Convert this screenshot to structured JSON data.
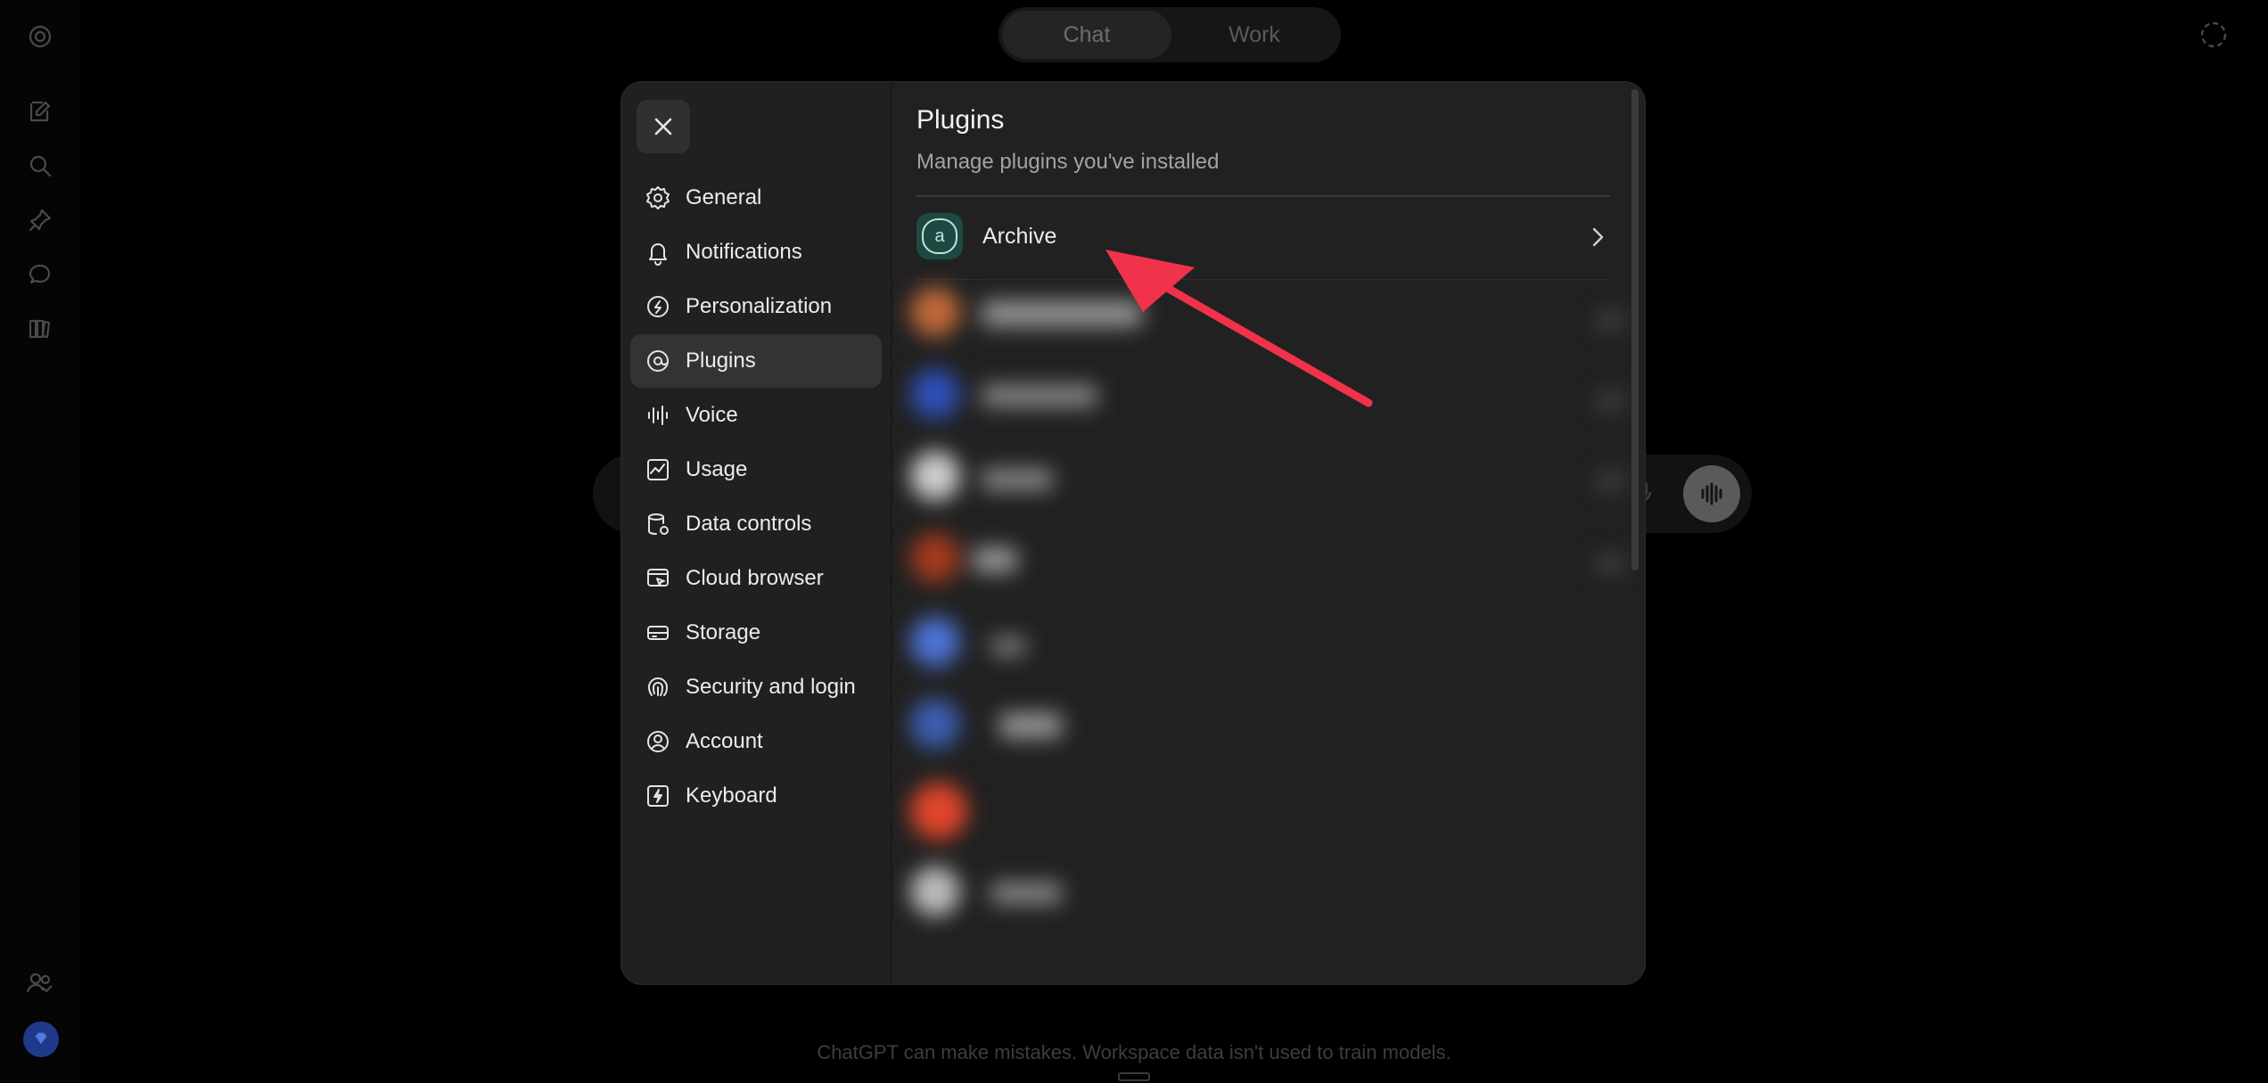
{
  "top_bar": {
    "tabs": [
      {
        "label": "Chat",
        "active": true
      },
      {
        "label": "Work",
        "active": false
      }
    ]
  },
  "left_rail": {
    "icons": [
      "logo-icon",
      "new-chat-icon",
      "search-icon",
      "pin-icon",
      "chat-bubble-icon",
      "library-icon",
      "team-icon",
      "avatar"
    ]
  },
  "settings": {
    "nav": [
      {
        "label": "General",
        "icon": "gear-icon",
        "active": false
      },
      {
        "label": "Notifications",
        "icon": "bell-icon",
        "active": false
      },
      {
        "label": "Personalization",
        "icon": "personalization-icon",
        "active": false
      },
      {
        "label": "Plugins",
        "icon": "plugin-icon",
        "active": true
      },
      {
        "label": "Voice",
        "icon": "waveform-icon",
        "active": false
      },
      {
        "label": "Usage",
        "icon": "usage-chart-icon",
        "active": false
      },
      {
        "label": "Data controls",
        "icon": "database-icon",
        "active": false
      },
      {
        "label": "Cloud browser",
        "icon": "cloud-browser-icon",
        "active": false
      },
      {
        "label": "Storage",
        "icon": "storage-icon",
        "active": false
      },
      {
        "label": "Security and login",
        "icon": "fingerprint-icon",
        "active": false
      },
      {
        "label": "Account",
        "icon": "user-circle-icon",
        "active": false
      },
      {
        "label": "Keyboard",
        "icon": "bolt-icon",
        "active": false
      }
    ],
    "content": {
      "title": "Plugins",
      "subtitle": "Manage plugins you've installed",
      "plugins": [
        {
          "name": "Archive",
          "logo_letter": "a"
        }
      ]
    }
  },
  "footer": {
    "note": "ChatGPT can make mistakes. Workspace data isn't used to train models."
  },
  "colors": {
    "modal_bg": "#212121",
    "active_nav": "#333333",
    "annotation_arrow": "#f0324a",
    "archive_logo": "#1c4a43"
  }
}
